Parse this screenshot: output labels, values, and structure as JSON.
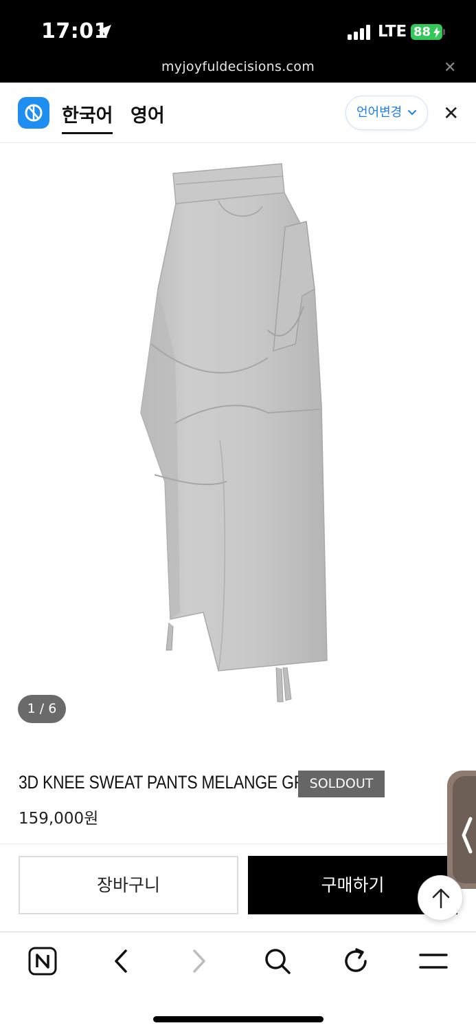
{
  "status_bar": {
    "time": "17:01",
    "network": "LTE",
    "battery": "88"
  },
  "browser": {
    "url": "myjoyfuldecisions.com"
  },
  "translate_bar": {
    "active_language": "한국어",
    "other_language": "영어",
    "change_language_label": "언어변경"
  },
  "product": {
    "image_counter": "1 / 6",
    "title": "3D KNEE SWEAT PANTS MELANGE GREY",
    "badge": "SOLDOUT",
    "price": "159,000원"
  },
  "actions": {
    "cart_label": "장바구니",
    "buy_label": "구매하기"
  },
  "colors": {
    "accent_blue": "#1f8ef1",
    "battery_green": "#34c759",
    "badge_grey": "#666666",
    "buy_button": "#000000"
  },
  "icons": {
    "location": "location-arrow-icon",
    "signal": "signal-icon",
    "translate_logo": "translate-logo-icon",
    "dropdown": "chevron-down-icon",
    "scroll_top": "arrow-up-icon",
    "toolbar": [
      "naver-home-icon",
      "back-icon",
      "forward-icon",
      "search-icon",
      "reload-icon",
      "menu-icon"
    ]
  }
}
